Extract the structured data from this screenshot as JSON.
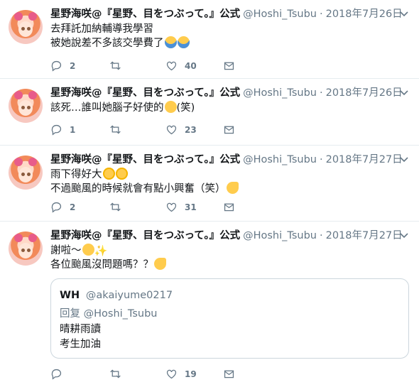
{
  "tweets": [
    {
      "name": "星野海咲@『星野、目をつぶって。』公式",
      "handle": "@Hoshi_Tsubu",
      "separator": "·",
      "date": "2018年7月26日",
      "lines": [
        "去拜託加納輔導我學習",
        "被她說差不多該交學費了"
      ],
      "emoji": [
        "face-screaming-icon",
        "face-screaming-icon"
      ],
      "replies": "2",
      "retweets": "",
      "likes": "40"
    },
    {
      "name": "星野海咲@『星野、目をつぶって。』公式",
      "handle": "@Hoshi_Tsubu",
      "separator": "·",
      "date": "2018年7月26日",
      "lines": [
        "該死…誰叫她腦子好使的",
        "(笑)"
      ],
      "emoji": [
        "smirking-face-icon"
      ],
      "replies": "1",
      "retweets": "",
      "likes": "23"
    },
    {
      "name": "星野海咲@『星野、目をつぶって。』公式",
      "handle": "@Hoshi_Tsubu",
      "separator": "·",
      "date": "2018年7月27日",
      "lines": [
        "雨下得好大",
        "不過颱風的時候就會有點小興奮（笑）"
      ],
      "emoji": [
        "worried-face-icon",
        "worried-face-icon",
        "grinning-sweat-face-icon"
      ],
      "replies": "2",
      "retweets": "",
      "likes": "31"
    },
    {
      "name": "星野海咲@『星野、目をつぶって。』公式",
      "handle": "@Hoshi_Tsubu",
      "separator": "·",
      "date": "2018年7月27日",
      "lines": [
        "謝啦～",
        "各位颱風沒問題嗎？？"
      ],
      "emoji": [
        "smiling-face-icon",
        "sparkles-icon",
        "grinning-sweat-face-icon"
      ],
      "replies": "",
      "retweets": "",
      "likes": "19",
      "quote": {
        "name": "WH",
        "handle": "@akaiyume0217",
        "reply_to": "回复 @Hoshi_Tsubu",
        "lines": [
          "晴耕雨讀",
          "考生加油"
        ]
      }
    }
  ],
  "colors": {
    "text": "#14171a",
    "muted": "#657786",
    "border": "#e6ecf0",
    "quote_border": "#ccd6dd"
  }
}
